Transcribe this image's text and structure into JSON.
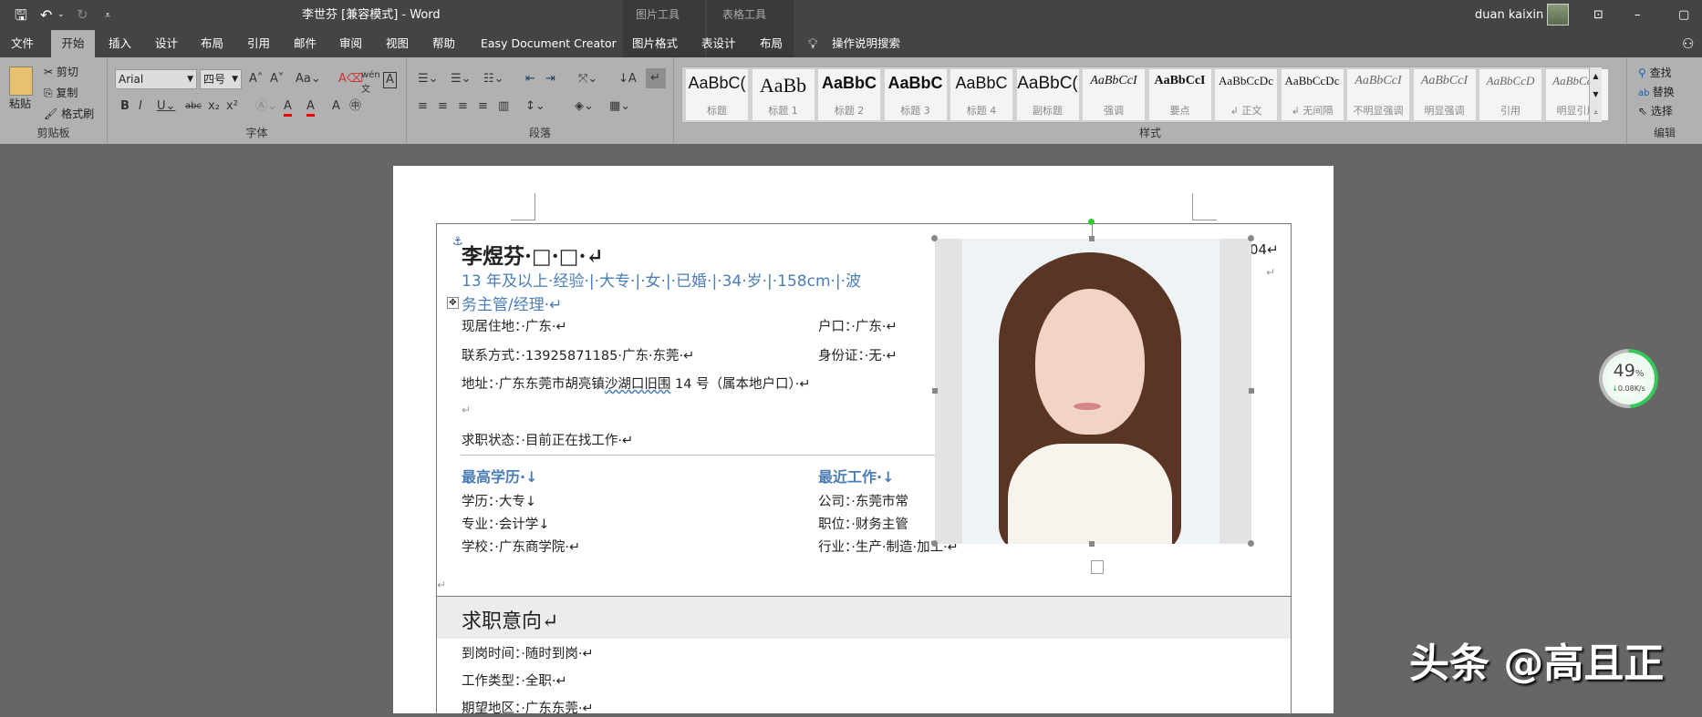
{
  "titlebar": {
    "title": "李世芬 [兼容模式]  -  Word",
    "context_picture": "图片工具",
    "context_table": "表格工具",
    "user": "duan kaixin",
    "qat": {
      "save": "save-icon",
      "undo": "undo-icon",
      "redo": "redo-icon",
      "customize": "customize-icon"
    }
  },
  "tabs": [
    "文件",
    "开始",
    "插入",
    "设计",
    "布局",
    "引用",
    "邮件",
    "审阅",
    "视图",
    "帮助",
    "Easy Document Creator",
    "图片格式",
    "表设计",
    "布局"
  ],
  "tell_me": "操作说明搜索",
  "clipboard": {
    "paste": "粘贴",
    "cut": "剪切",
    "copy": "复制",
    "format_painter": "格式刷",
    "label": "剪贴板"
  },
  "font": {
    "name": "Arial",
    "size": "四号",
    "label": "字体"
  },
  "paragraph": {
    "label": "段落"
  },
  "styles": {
    "label": "样式",
    "items": [
      {
        "sample": "AaBbC(",
        "name": "标题"
      },
      {
        "sample": "AaBb",
        "name": "标题 1"
      },
      {
        "sample": "AaBbC",
        "name": "标题 2"
      },
      {
        "sample": "AaBbC",
        "name": "标题 3"
      },
      {
        "sample": "AaBbC",
        "name": "标题 4"
      },
      {
        "sample": "AaBbC(",
        "name": "副标题"
      },
      {
        "sample": "AaBbCcI",
        "name": "强调"
      },
      {
        "sample": "AaBbCcI",
        "name": "要点"
      },
      {
        "sample": "AaBbCcDc",
        "name": "↲ 正文"
      },
      {
        "sample": "AaBbCcDc",
        "name": "↲ 无间隔"
      },
      {
        "sample": "AaBbCcI",
        "name": "不明显强调"
      },
      {
        "sample": "AaBbCcI",
        "name": "明显强调"
      },
      {
        "sample": "AaBbCcD",
        "name": "引用"
      },
      {
        "sample": "AaBbCcD",
        "name": "明显引用"
      }
    ]
  },
  "editing": {
    "find": "查找",
    "replace": "替换",
    "select": "选择",
    "label": "编辑"
  },
  "doc": {
    "name": "李煜芬·□·□·↵",
    "summary1": "13 年及以上·经验·|·大专·|·女·|·已婚·|·34·岁·|·158cm·|·波",
    "summary2": "务主管/经理·↵",
    "right_frag1": "04↵",
    "right_frag2": "↵",
    "residence": "现居住地：·广东·↵",
    "hukou": "户口：·广东·↵",
    "contact": "联系方式：·13925871185·广东·东莞·↵",
    "id_card": "身份证：·无·↵",
    "address_pre": "地址：·广东东莞市胡亮镇",
    "address_sq": "沙湖口旧围",
    "address_post": " 14 号（属本地户口）·↵",
    "empty": "↵",
    "status": "求职状态：·目前正在找工作·↵",
    "edu_title": "最高学历·↓",
    "work_title": "最近工作·↓",
    "degree": "学历：·大专↓",
    "major": "专业：·会计学↓",
    "school": "学校：·广东商学院·↵",
    "company": "公司：·东莞市常",
    "position": "职位：·财务主管",
    "industry": "行业：·生产·制造·加工·↵",
    "intent_title": "求职意向↵",
    "arrival": "到岗时间：·随时到岗·↵",
    "job_type": "工作类型：·全职·↵",
    "region": "期望地区：·广东东莞·↵"
  },
  "net_widget": {
    "percent": "49",
    "unit": "%",
    "speed": "0.08K/s",
    "value": 49
  },
  "watermark": "头条 @高且正"
}
